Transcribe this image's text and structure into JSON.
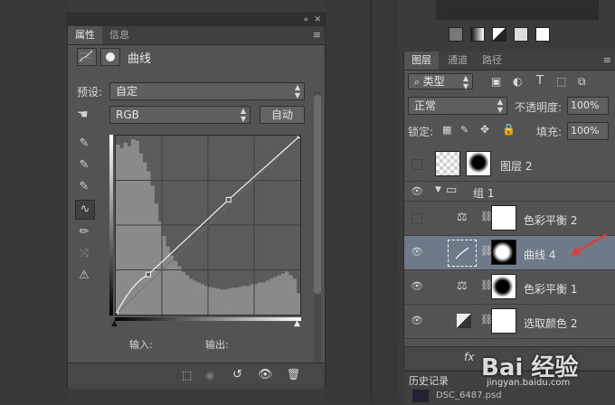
{
  "properties_panel": {
    "tabs": [
      "属性",
      "信息"
    ],
    "header_title": "曲线",
    "preset_label": "预设:",
    "preset_value": "自定",
    "channel_value": "RGB",
    "auto_button": "自动",
    "input_label": "输入:",
    "output_label": "输出:"
  },
  "curve": {
    "points": [
      [
        0,
        0
      ],
      [
        35,
        45
      ],
      [
        121,
        129
      ],
      [
        198,
        201
      ]
    ],
    "histogram_heights": [
      0.95,
      0.93,
      0.96,
      0.94,
      0.98,
      0.97,
      0.9,
      0.85,
      0.8,
      0.72,
      0.62,
      0.52,
      0.44,
      0.38,
      0.33,
      0.3,
      0.27,
      0.24,
      0.22,
      0.2,
      0.19,
      0.18,
      0.17,
      0.16,
      0.155,
      0.15,
      0.145,
      0.14,
      0.14,
      0.145,
      0.15,
      0.15,
      0.155,
      0.16,
      0.16,
      0.17,
      0.17,
      0.18,
      0.18,
      0.19,
      0.2,
      0.21,
      0.22,
      0.23,
      0.24,
      0.22,
      0.2,
      0.12
    ]
  },
  "layers_panel": {
    "tabs": [
      "图层",
      "通道",
      "路径"
    ],
    "filter_label": "类型",
    "blend_mode": "正常",
    "opacity_label": "不透明度:",
    "opacity_value": "100%",
    "lock_label": "锁定:",
    "fill_label": "填充:",
    "fill_value": "100%",
    "layers": [
      {
        "name": "图层 2",
        "type": "layer"
      },
      {
        "name": "组 1",
        "type": "group"
      },
      {
        "name": "色彩平衡 2",
        "type": "balance"
      },
      {
        "name": "曲线 4",
        "type": "curves",
        "selected": true
      },
      {
        "name": "色彩平衡 1",
        "type": "balance"
      },
      {
        "name": "选取颜色 2",
        "type": "selective"
      }
    ]
  },
  "history_panel": {
    "tab": "历史记录",
    "item": "DSC_6487.psd"
  },
  "watermark": "Bai 经验",
  "watermark_url": "jingyan.baidu.com",
  "colors": {
    "accent_red": "#e03a3a",
    "selected_row": "#6f7a88"
  }
}
